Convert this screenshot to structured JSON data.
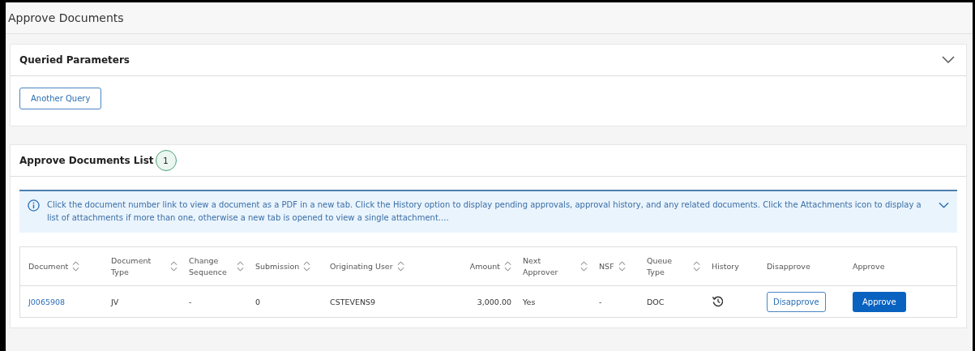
{
  "page": {
    "title": "Approve Documents"
  },
  "query_panel": {
    "title": "Queried Parameters",
    "expanded": true,
    "button": "Another Query"
  },
  "list_panel": {
    "title": "Approve Documents List",
    "count": "1",
    "info": {
      "text": "Click the document number link to view a document as a PDF in a new tab. Click the History option to display pending approvals, approval history, and any related documents. Click the Attachments icon to display a list of attachments if more than one, otherwise a new tab is opened to view a single attachment....",
      "expanded": false
    },
    "table": {
      "columns": [
        {
          "label": "Document",
          "sortable": true
        },
        {
          "label": "Document Type",
          "sortable": true
        },
        {
          "label": "Change Sequence",
          "sortable": true
        },
        {
          "label": "Submission",
          "sortable": true
        },
        {
          "label": "Originating User",
          "sortable": true
        },
        {
          "label": "Amount",
          "sortable": true,
          "kind": "number"
        },
        {
          "label": "Next Approver",
          "sortable": true
        },
        {
          "label": "NSF",
          "sortable": true
        },
        {
          "label": "Queue Type",
          "sortable": true
        },
        {
          "label": "History",
          "sortable": false
        },
        {
          "label": "Disapprove",
          "sortable": false
        },
        {
          "label": "Approve",
          "sortable": false
        }
      ],
      "rows": [
        [
          {
            "kind": "link",
            "text": "J0065908"
          },
          {
            "kind": "text",
            "text": "JV"
          },
          {
            "kind": "text",
            "text": "-"
          },
          {
            "kind": "text",
            "text": "0"
          },
          {
            "kind": "text",
            "text": "CSTEVENS9"
          },
          {
            "kind": "number",
            "text": "3,000.00"
          },
          {
            "kind": "text",
            "text": "Yes"
          },
          {
            "kind": "text",
            "text": "-"
          },
          {
            "kind": "text",
            "text": "DOC"
          },
          {
            "kind": "history"
          },
          {
            "kind": "secondary-button",
            "text": "Disapprove"
          },
          {
            "kind": "primary-button",
            "text": "Approve"
          }
        ]
      ]
    }
  }
}
